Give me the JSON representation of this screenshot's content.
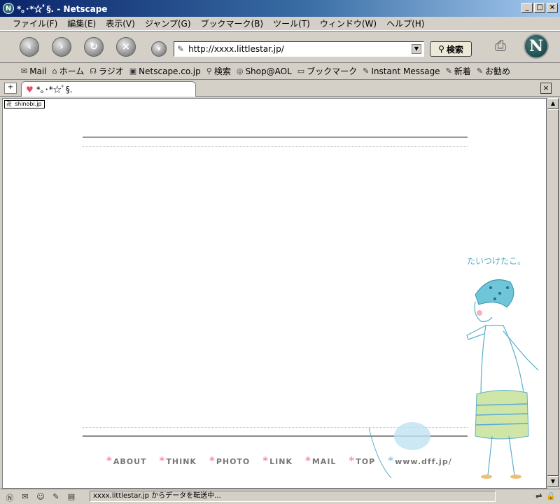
{
  "window": {
    "title": "*｡･*☆ﾟ§. - Netscape"
  },
  "menu": [
    "ファイル(F)",
    "編集(E)",
    "表示(V)",
    "ジャンプ(G)",
    "ブックマーク(B)",
    "ツール(T)",
    "ウィンドウ(W)",
    "ヘルプ(H)"
  ],
  "nav": {
    "url": "http://xxxx.littlestar.jp/",
    "search_label": "検索"
  },
  "personal_toolbar": [
    "Mail",
    "ホーム",
    "ラジオ",
    "Netscape.co.jp",
    "検索",
    "Shop@AOL",
    "ブックマーク",
    "Instant Message",
    "新着",
    "お勧め"
  ],
  "tab": {
    "title": "*｡･*☆ﾟ§."
  },
  "page": {
    "badge": "shinobi.jp",
    "illustration_caption": "たいつけたこ。",
    "footer_nav": [
      "ABOUT",
      "THINK",
      "PHOTO",
      "LINK",
      "MAIL",
      "TOP",
      "www.dff.jp/"
    ]
  },
  "status": {
    "text": "xxxx.littlestar.jp からデータを転送中..."
  },
  "colors": {
    "accent_star": "#ff8ea8",
    "accent_blue": "#8ec8e8",
    "title_bar": "#0a246a"
  }
}
